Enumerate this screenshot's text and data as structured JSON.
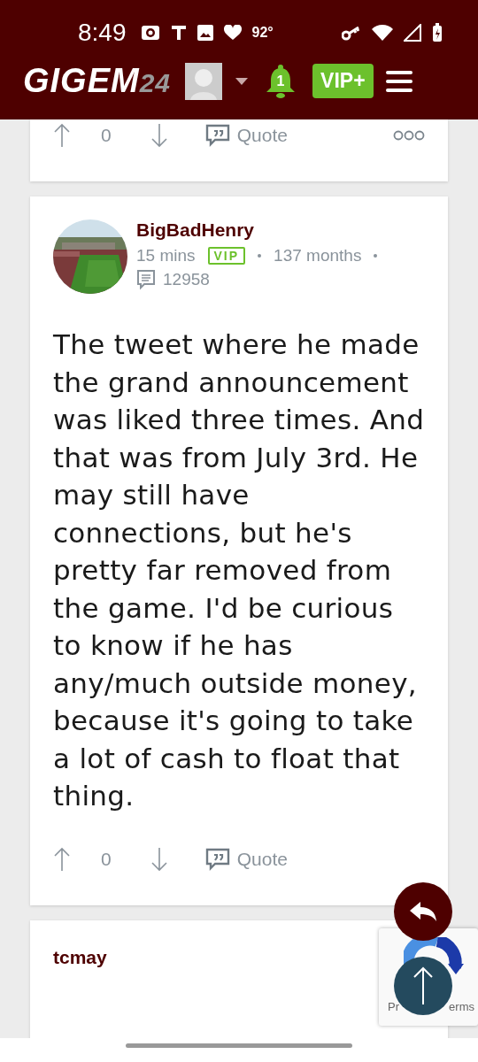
{
  "status_bar": {
    "time": "8:49",
    "temperature": "92°"
  },
  "header": {
    "logo_main": "GIGEM",
    "logo_accent": "24",
    "notification_count": "1",
    "vip_label": "VIP+"
  },
  "posts": [
    {
      "show_header": false,
      "votes": "0",
      "quote_label": "Quote",
      "more_menu": true
    },
    {
      "show_header": true,
      "author": "BigBadHenry",
      "time": "15 mins",
      "badge": "VIP",
      "tenure": "137 months",
      "post_count": "12958",
      "body": "The tweet where he made the grand announcement was liked three times. And that was from July 3rd. He may still have connections, but he's pretty far removed from the game. I'd be curious to know if he has any/much outside money, because it's going to take a lot of cash to float that thing.",
      "votes": "0",
      "quote_label": "Quote",
      "more_menu": false
    },
    {
      "show_header": true,
      "author": "tcmay"
    }
  ],
  "captcha": {
    "left_text": "Pr",
    "right_text": "erms"
  }
}
